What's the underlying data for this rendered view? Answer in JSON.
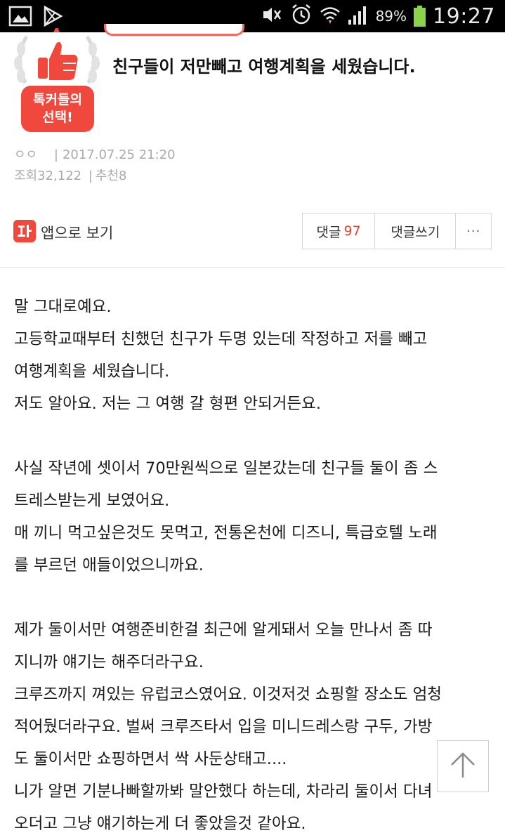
{
  "status_bar": {
    "battery_pct": "89%",
    "time": "19:27",
    "icons": [
      "gallery-icon",
      "play-store-icon",
      "mute-icon",
      "alarm-icon",
      "wifi-icon",
      "signal-icon",
      "battery-icon"
    ]
  },
  "badge": {
    "line1": "톡커들의",
    "line2": "선택!",
    "color": "#f0483c"
  },
  "post": {
    "title": "친구들이 저만빼고 여행계획을 세웠습니다.",
    "author": "ㅇㅇ",
    "date": "2017.07.25 21:20",
    "views_label": "조회",
    "views": "32,122",
    "recommend_label": "추천",
    "recommend": "8"
  },
  "actions": {
    "app_view": "앱으로 보기",
    "comments_label": "댓글",
    "comments_count": "97",
    "write_comment": "댓글쓰기",
    "more": "···"
  },
  "body_lines": [
    "말 그대로예요.",
    "고등학교때부터 친했던 친구가 두명 있는데 작정하고 저를 빼고",
    "여행계획을 세웠습니다.",
    "저도 알아요. 저는 그 여행 갈 형편 안되거든요.",
    "",
    "사실 작년에 셋이서 70만원씩으로 일본갔는데 친구들 둘이 좀 스",
    "트레스받는게 보였어요.",
    "매 끼니 먹고싶은것도 못먹고, 전통온천에 디즈니, 특급호텔 노래",
    "를 부르던 애들이었으니까요.",
    "",
    "제가 둘이서만 여행준비한걸 최근에 알게돼서 오늘 만나서 좀 따",
    "지니까 얘기는 해주더라구요.",
    "크루즈까지 껴있는 유럽코스였어요. 이것저것 쇼핑할 장소도 엄청",
    "적어뒀더라구요. 벌써 크루즈타서 입을 미니드레스랑 구두, 가방",
    "도 둘이서만 쇼핑하면서 싹 사둔상태고....",
    "니가 알면 기분나빠할까봐 말안했다 하는데, 차라리 둘이서 다녀",
    "오더고 그냥 얘기하는게 더 좋았을것 같아요."
  ],
  "colors": {
    "accent": "#e8423a",
    "badge_red": "#f0483c",
    "meta_gray": "#aaaaaa"
  }
}
